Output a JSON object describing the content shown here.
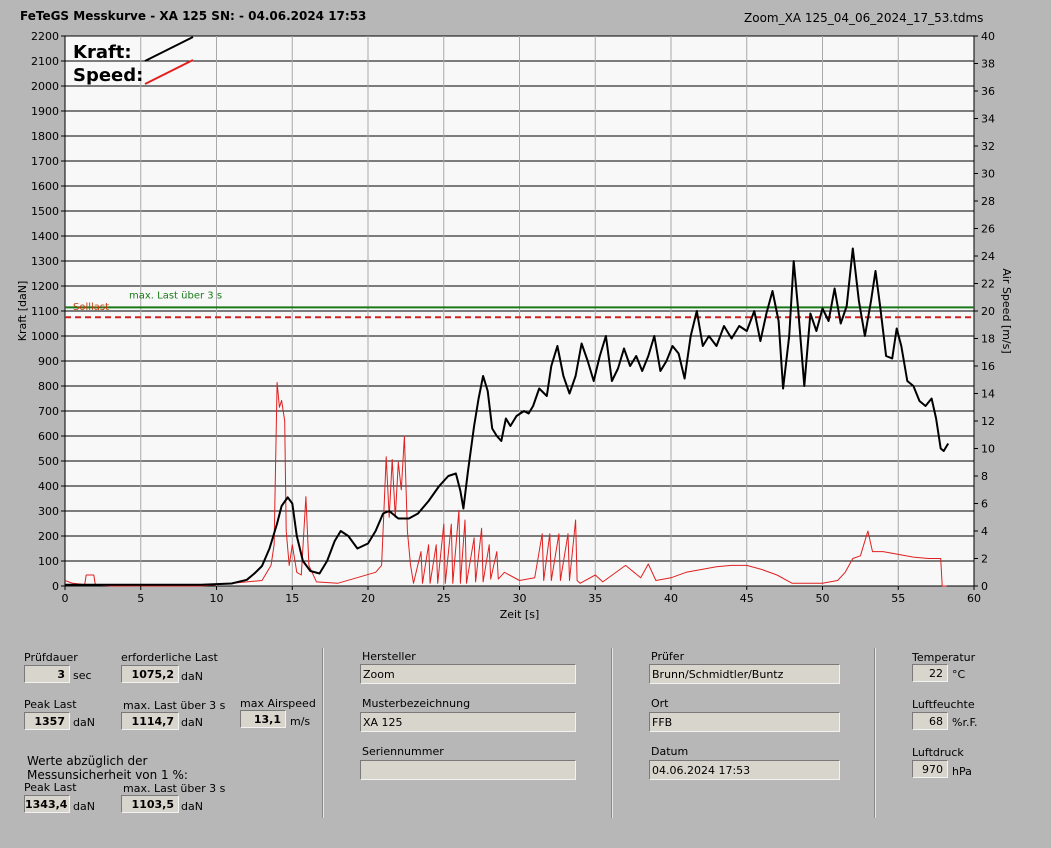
{
  "header": {
    "title": "FeTeGS Messkurve - XA 125  SN:  - 04.06.2024 17:53",
    "filename": "Zoom_XA 125_04_06_2024_17_53.tdms"
  },
  "chart_data": {
    "type": "line",
    "xlabel": "Zeit [s]",
    "ylabel": "Kraft [daN]",
    "y2label": "Air Speed [m/s]",
    "xlim": [
      0,
      60
    ],
    "ylim": [
      0,
      2200
    ],
    "y2lim": [
      0,
      40
    ],
    "x_ticks": [
      0,
      5,
      10,
      15,
      20,
      25,
      30,
      35,
      40,
      45,
      50,
      55,
      60
    ],
    "y_ticks": [
      0,
      100,
      200,
      300,
      400,
      500,
      600,
      700,
      800,
      900,
      1000,
      1100,
      1200,
      1300,
      1400,
      1500,
      1600,
      1700,
      1800,
      1900,
      2000,
      2100,
      2200
    ],
    "y2_ticks": [
      0,
      2,
      4,
      6,
      8,
      10,
      12,
      14,
      16,
      18,
      20,
      22,
      24,
      26,
      28,
      30,
      32,
      34,
      36,
      38,
      40
    ],
    "grid": true,
    "legend": [
      {
        "name": "Kraft:",
        "color": "#000000"
      },
      {
        "name": "Speed:",
        "color": "#e02020"
      }
    ],
    "reference_lines": [
      {
        "name": "max. Last über  3 s",
        "value": 1114.7,
        "color": "#1a7a1a",
        "style": "solid"
      },
      {
        "name": "Solllast",
        "value": 1075.2,
        "color": "#d02020",
        "style": "dashed"
      }
    ],
    "series": [
      {
        "name": "Kraft:",
        "axis": "left",
        "color": "#000000",
        "points": [
          [
            0,
            5
          ],
          [
            5,
            5
          ],
          [
            9,
            5
          ],
          [
            11,
            10
          ],
          [
            12,
            25
          ],
          [
            12.5,
            50
          ],
          [
            13,
            80
          ],
          [
            13.5,
            150
          ],
          [
            14,
            250
          ],
          [
            14.3,
            320
          ],
          [
            14.7,
            355
          ],
          [
            15,
            330
          ],
          [
            15.3,
            200
          ],
          [
            15.7,
            100
          ],
          [
            16.2,
            60
          ],
          [
            16.8,
            50
          ],
          [
            17.3,
            100
          ],
          [
            17.8,
            180
          ],
          [
            18.2,
            220
          ],
          [
            18.7,
            200
          ],
          [
            19.3,
            150
          ],
          [
            20,
            170
          ],
          [
            20.5,
            220
          ],
          [
            21,
            290
          ],
          [
            21.4,
            300
          ],
          [
            22,
            270
          ],
          [
            22.7,
            270
          ],
          [
            23.3,
            290
          ],
          [
            24,
            340
          ],
          [
            24.7,
            400
          ],
          [
            25.3,
            440
          ],
          [
            25.8,
            450
          ],
          [
            26.1,
            380
          ],
          [
            26.3,
            310
          ],
          [
            26.6,
            460
          ],
          [
            27,
            640
          ],
          [
            27.3,
            750
          ],
          [
            27.6,
            840
          ],
          [
            27.9,
            780
          ],
          [
            28.2,
            630
          ],
          [
            28.5,
            600
          ],
          [
            28.8,
            580
          ],
          [
            29.1,
            670
          ],
          [
            29.4,
            640
          ],
          [
            29.8,
            680
          ],
          [
            30.3,
            700
          ],
          [
            30.6,
            690
          ],
          [
            30.9,
            720
          ],
          [
            31.3,
            790
          ],
          [
            31.8,
            760
          ],
          [
            32.1,
            880
          ],
          [
            32.5,
            960
          ],
          [
            32.9,
            840
          ],
          [
            33.3,
            770
          ],
          [
            33.7,
            840
          ],
          [
            34.1,
            970
          ],
          [
            34.5,
            900
          ],
          [
            34.9,
            820
          ],
          [
            35.3,
            920
          ],
          [
            35.7,
            1000
          ],
          [
            36.1,
            820
          ],
          [
            36.5,
            870
          ],
          [
            36.9,
            950
          ],
          [
            37.3,
            880
          ],
          [
            37.7,
            920
          ],
          [
            38.1,
            860
          ],
          [
            38.5,
            920
          ],
          [
            38.9,
            1000
          ],
          [
            39.3,
            860
          ],
          [
            39.7,
            900
          ],
          [
            40.1,
            960
          ],
          [
            40.5,
            930
          ],
          [
            40.9,
            830
          ],
          [
            41.3,
            1000
          ],
          [
            41.7,
            1100
          ],
          [
            42.1,
            960
          ],
          [
            42.5,
            1000
          ],
          [
            43,
            960
          ],
          [
            43.5,
            1040
          ],
          [
            44,
            990
          ],
          [
            44.5,
            1040
          ],
          [
            45,
            1020
          ],
          [
            45.5,
            1100
          ],
          [
            45.9,
            980
          ],
          [
            46.3,
            1090
          ],
          [
            46.7,
            1180
          ],
          [
            47.1,
            1060
          ],
          [
            47.4,
            790
          ],
          [
            47.8,
            1000
          ],
          [
            48.1,
            1300
          ],
          [
            48.4,
            1100
          ],
          [
            48.8,
            800
          ],
          [
            49.2,
            1090
          ],
          [
            49.6,
            1020
          ],
          [
            50,
            1110
          ],
          [
            50.4,
            1060
          ],
          [
            50.8,
            1190
          ],
          [
            51.2,
            1050
          ],
          [
            51.6,
            1120
          ],
          [
            52,
            1350
          ],
          [
            52.4,
            1140
          ],
          [
            52.8,
            1000
          ],
          [
            53.2,
            1140
          ],
          [
            53.5,
            1260
          ],
          [
            53.8,
            1120
          ],
          [
            54.2,
            920
          ],
          [
            54.6,
            910
          ],
          [
            54.9,
            1030
          ],
          [
            55.2,
            960
          ],
          [
            55.6,
            820
          ],
          [
            56,
            800
          ],
          [
            56.4,
            740
          ],
          [
            56.8,
            720
          ],
          [
            57.2,
            750
          ],
          [
            57.5,
            670
          ],
          [
            57.8,
            550
          ],
          [
            58,
            540
          ],
          [
            58.3,
            570
          ]
        ]
      },
      {
        "name": "Speed:",
        "axis": "right",
        "color": "#e02020",
        "points": [
          [
            0,
            0.4
          ],
          [
            0.5,
            0.2
          ],
          [
            1.3,
            0.1
          ],
          [
            1.4,
            0.8
          ],
          [
            1.9,
            0.8
          ],
          [
            2,
            0.1
          ],
          [
            3,
            0
          ],
          [
            9,
            0
          ],
          [
            11,
            0.2
          ],
          [
            13,
            0.4
          ],
          [
            13.6,
            1.5
          ],
          [
            13.8,
            3
          ],
          [
            14,
            14.8
          ],
          [
            14.15,
            13
          ],
          [
            14.3,
            13.5
          ],
          [
            14.5,
            12
          ],
          [
            14.6,
            4
          ],
          [
            14.8,
            1.5
          ],
          [
            15,
            3
          ],
          [
            15.3,
            1
          ],
          [
            15.6,
            0.8
          ],
          [
            15.9,
            6.5
          ],
          [
            16.1,
            1.5
          ],
          [
            16.6,
            0.3
          ],
          [
            18,
            0.2
          ],
          [
            20.5,
            1
          ],
          [
            20.9,
            1.5
          ],
          [
            21.2,
            9.4
          ],
          [
            21.4,
            5
          ],
          [
            21.6,
            9.2
          ],
          [
            21.8,
            5
          ],
          [
            22,
            9
          ],
          [
            22.2,
            7
          ],
          [
            22.4,
            10.9
          ],
          [
            22.6,
            4
          ],
          [
            22.8,
            1.6
          ],
          [
            23,
            0.2
          ],
          [
            23.5,
            2.5
          ],
          [
            23.6,
            0.2
          ],
          [
            24,
            3
          ],
          [
            24.1,
            0.2
          ],
          [
            24.5,
            3
          ],
          [
            24.6,
            0.2
          ],
          [
            25,
            4.5
          ],
          [
            25.1,
            0.2
          ],
          [
            25.5,
            4.5
          ],
          [
            25.6,
            0.2
          ],
          [
            26,
            5.5
          ],
          [
            26.1,
            0.2
          ],
          [
            26.4,
            4.8
          ],
          [
            26.5,
            0.2
          ],
          [
            27,
            3.5
          ],
          [
            27.1,
            0.3
          ],
          [
            27.5,
            4.2
          ],
          [
            27.6,
            0.3
          ],
          [
            28,
            3
          ],
          [
            28.1,
            0.5
          ],
          [
            28.5,
            2.5
          ],
          [
            28.6,
            0.5
          ],
          [
            29,
            1
          ],
          [
            30,
            0.4
          ],
          [
            31,
            0.6
          ],
          [
            31.5,
            3.8
          ],
          [
            31.6,
            0.4
          ],
          [
            32,
            3.8
          ],
          [
            32.1,
            0.4
          ],
          [
            32.6,
            3.8
          ],
          [
            32.7,
            0.4
          ],
          [
            33.2,
            3.8
          ],
          [
            33.3,
            0.4
          ],
          [
            33.7,
            4.8
          ],
          [
            33.8,
            0.4
          ],
          [
            34,
            0.2
          ],
          [
            35,
            0.8
          ],
          [
            35.5,
            0.3
          ],
          [
            37,
            1.5
          ],
          [
            38,
            0.6
          ],
          [
            38.5,
            1.6
          ],
          [
            39,
            0.4
          ],
          [
            40,
            0.6
          ],
          [
            41,
            1
          ],
          [
            42,
            1.2
          ],
          [
            43,
            1.4
          ],
          [
            44,
            1.5
          ],
          [
            45,
            1.5
          ],
          [
            46,
            1.2
          ],
          [
            47,
            0.8
          ],
          [
            48,
            0.2
          ],
          [
            50,
            0.2
          ],
          [
            51,
            0.4
          ],
          [
            51.5,
            1
          ],
          [
            52,
            2
          ],
          [
            52.5,
            2.2
          ],
          [
            53,
            4
          ],
          [
            53.3,
            2.5
          ],
          [
            54,
            2.5
          ],
          [
            55,
            2.3
          ],
          [
            56,
            2.1
          ],
          [
            57,
            2
          ],
          [
            57.8,
            2
          ],
          [
            57.9,
            0
          ],
          [
            58.2,
            0
          ]
        ]
      }
    ]
  },
  "panel": {
    "pruefdauer": {
      "label": "Prüfdauer",
      "value": "3",
      "unit": "sec"
    },
    "erf_last": {
      "label": "erforderliche Last",
      "value": "1075,2",
      "unit": "daN"
    },
    "peak_last": {
      "label": "Peak Last",
      "value": "1357",
      "unit": "daN"
    },
    "max_last": {
      "label": "max. Last über  3 s",
      "value": "1114,7",
      "unit": "daN"
    },
    "max_airspeed": {
      "label": "max Airspeed",
      "value": "13,1",
      "unit": "m/s"
    },
    "note_line1": "Werte abzüglich der",
    "note_line2": "Messunsicherheit von 1  %:",
    "peak_last2": {
      "label": "Peak Last",
      "value": "1343,4",
      "unit": "daN"
    },
    "max_last2": {
      "label": "max. Last über  3 s",
      "value": "1103,5",
      "unit": "daN"
    },
    "hersteller": {
      "label": "Hersteller",
      "value": "Zoom"
    },
    "muster": {
      "label": "Musterbezeichnung",
      "value": "XA 125"
    },
    "serie": {
      "label": "Seriennummer",
      "value": ""
    },
    "pruefer": {
      "label": "Prüfer",
      "value": "Brunn/Schmidtler/Buntz"
    },
    "ort": {
      "label": "Ort",
      "value": "FFB"
    },
    "datum": {
      "label": "Datum",
      "value": "04.06.2024 17:53"
    },
    "temperatur": {
      "label": "Temperatur",
      "value": "22",
      "unit": "°C"
    },
    "luftfeuchte": {
      "label": "Luftfeuchte",
      "value": "68",
      "unit": "%r.F."
    },
    "luftdruck": {
      "label": "Luftdruck",
      "value": "970",
      "unit": "hPa"
    }
  }
}
